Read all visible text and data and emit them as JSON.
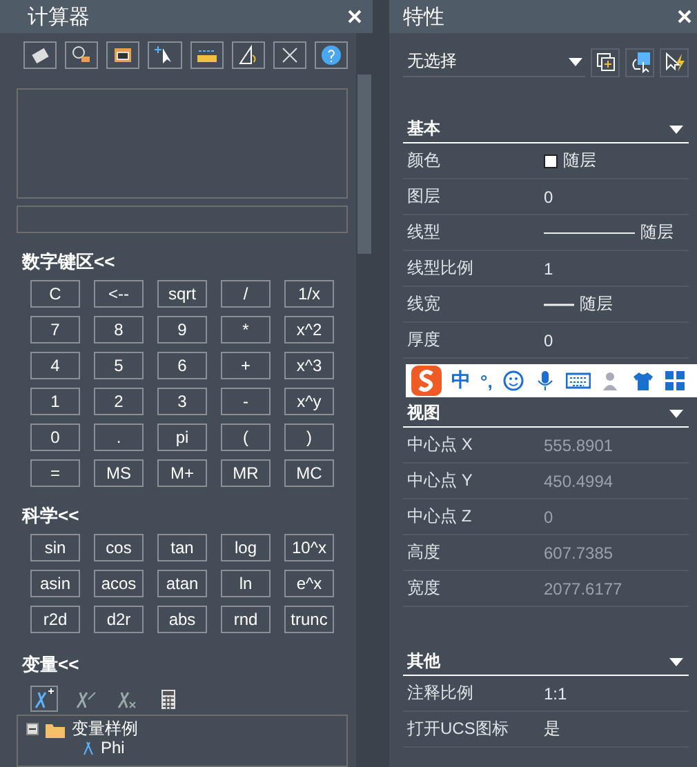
{
  "calculator": {
    "title": "计算器",
    "sections": [
      {
        "title": "数字键区<<",
        "keys": [
          "C",
          "<--",
          "sqrt",
          "/",
          "1/x",
          "7",
          "8",
          "9",
          "*",
          "x^2",
          "4",
          "5",
          "6",
          "+",
          "x^3",
          "1",
          "2",
          "3",
          "-",
          "x^y",
          "0",
          ".",
          "pi",
          "(",
          ")",
          "=",
          "MS",
          "M+",
          "MR",
          "MC"
        ]
      },
      {
        "title": "科学<<",
        "keys": [
          "sin",
          "cos",
          "tan",
          "log",
          "10^x",
          "asin",
          "acos",
          "atan",
          "ln",
          "e^x",
          "r2d",
          "d2r",
          "abs",
          "rnd",
          "trunc"
        ]
      }
    ],
    "variables": {
      "title": "变量<<",
      "tree": [
        {
          "label": "变量样例",
          "expanded": true,
          "children": [
            {
              "label": "Phi"
            }
          ]
        }
      ]
    }
  },
  "properties": {
    "title": "特性",
    "selector": {
      "value": "无选择"
    },
    "ime": {
      "mode": "中",
      "punct": "°,"
    },
    "groups": [
      {
        "title": "基本",
        "expanded": true,
        "rows": [
          {
            "label": "颜色",
            "value": "随层",
            "kind": "color",
            "color": "#ffffff",
            "readonly": false
          },
          {
            "label": "图层",
            "value": "0",
            "kind": "text",
            "readonly": false
          },
          {
            "label": "线型",
            "value": "随层",
            "kind": "line",
            "readonly": false
          },
          {
            "label": "线型比例",
            "value": "1",
            "kind": "text",
            "readonly": false
          },
          {
            "label": "线宽",
            "value": "随层",
            "kind": "shortline",
            "readonly": false
          },
          {
            "label": "厚度",
            "value": "0",
            "kind": "text",
            "readonly": false
          }
        ]
      },
      {
        "title": "视图",
        "expanded": true,
        "rows": [
          {
            "label": "中心点 X",
            "value": "555.8901",
            "kind": "text",
            "readonly": true
          },
          {
            "label": "中心点 Y",
            "value": "450.4994",
            "kind": "text",
            "readonly": true
          },
          {
            "label": "中心点 Z",
            "value": "0",
            "kind": "text",
            "readonly": true
          },
          {
            "label": "高度",
            "value": "607.7385",
            "kind": "text",
            "readonly": true
          },
          {
            "label": "宽度",
            "value": "2077.6177",
            "kind": "text",
            "readonly": true
          }
        ]
      },
      {
        "title": "其他",
        "expanded": true,
        "rows": [
          {
            "label": "注释比例",
            "value": "1:1",
            "kind": "text",
            "readonly": false
          },
          {
            "label": "打开UCS图标",
            "value": "是",
            "kind": "text",
            "readonly": false
          }
        ]
      }
    ]
  }
}
